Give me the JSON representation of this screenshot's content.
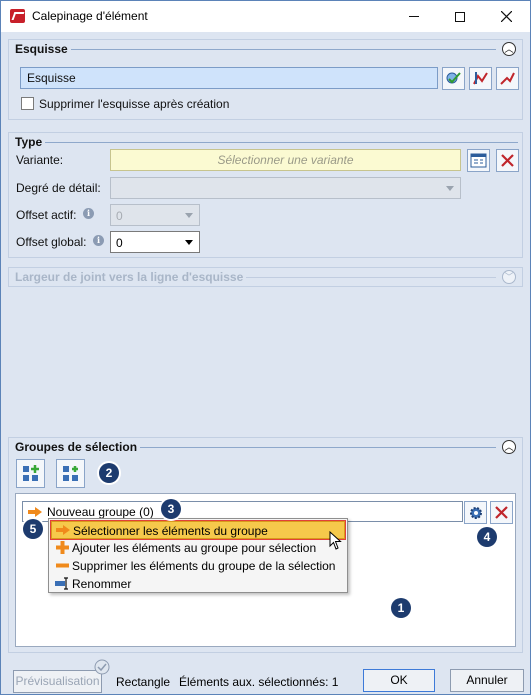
{
  "window": {
    "title": "Calepinage d'élément"
  },
  "sections": {
    "esquisse": {
      "title": "Esquisse",
      "field_value": "Esquisse",
      "checkbox_label": "Supprimer l'esquisse après création",
      "checkbox_checked": false
    },
    "type": {
      "title": "Type",
      "variante_label": "Variante:",
      "variante_placeholder": "Sélectionner une variante",
      "degre_label": "Degré de détail:",
      "offset_actif_label": "Offset actif:",
      "offset_actif_value": "0",
      "offset_global_label": "Offset global:",
      "offset_global_value": "0"
    },
    "joint": {
      "title": "Largeur de joint vers la ligne d'esquisse"
    },
    "groupes": {
      "title": "Groupes de sélection",
      "group_name": "Nouveau groupe (0)",
      "menu_items": [
        "Sélectionner les éléments du groupe",
        "Ajouter les éléments au groupe pour sélection",
        "Supprimer les éléments du groupe de la sélection",
        "Renommer"
      ]
    }
  },
  "badges": [
    "1",
    "2",
    "3",
    "4",
    "5"
  ],
  "footer": {
    "preview_label": "Prévisualisation",
    "shape_label": "Rectangle",
    "status_label": "Éléments aux. sélectionnés: 1",
    "ok_label": "OK",
    "cancel_label": "Annuler"
  },
  "colors": {
    "accent": "#1d3b6e",
    "highlight": "#f6c94b",
    "field_blue": "#cfe3fb",
    "variant_yellow": "#fbfad2"
  }
}
